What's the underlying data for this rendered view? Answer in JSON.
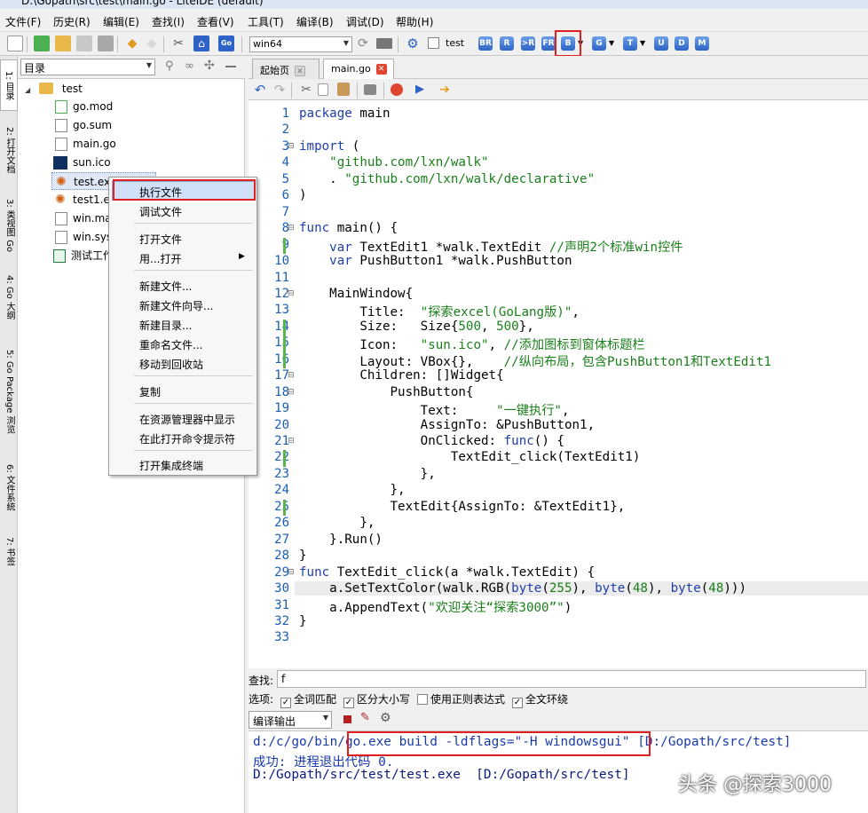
{
  "window": {
    "title": "D:\\Gopath\\src\\test\\main.go - LiteIDE (default)"
  },
  "menubar": [
    "文件(F)",
    "历史(R)",
    "编辑(E)",
    "查找(I)",
    "查看(V)",
    "工具(T)",
    "编译(B)",
    "调试(D)",
    "帮助(H)"
  ],
  "toolbar": {
    "platform": "win64",
    "test_label": "test",
    "build_buttons": [
      "BR",
      "R",
      ">R",
      "FR",
      "B",
      "G",
      "T",
      "U",
      "D",
      "M"
    ]
  },
  "vertical_tabs": [
    "1: 目录",
    "2: 打开文档",
    "3: 类视图 Go",
    "4: Go 大纲",
    "5: Go Package 浏览",
    "6: 文件系统",
    "7: 书签"
  ],
  "sidebar": {
    "combo": "目录",
    "root": "test",
    "files": [
      "go.mod",
      "go.sum",
      "main.go",
      "sun.ico",
      "test.exe",
      "test1.exe",
      "win.manifest",
      "win.syso",
      "测试工作簿.xlsx"
    ]
  },
  "context_menu": {
    "items": [
      "执行文件",
      "调试文件",
      "打开文件",
      "用...打开",
      "新建文件...",
      "新建文件向导...",
      "新建目录...",
      "重命名文件...",
      "移动到回收站",
      "复制",
      "在资源管理器中显示",
      "在此打开命令提示符",
      "打开集成终端"
    ]
  },
  "editor": {
    "tabs": [
      "起始页",
      "main.go"
    ],
    "active_tab": "main.go",
    "line_count": 33,
    "lines": [
      "package main",
      "",
      "import (",
      "    \"github.com/lxn/walk\"",
      "    . \"github.com/lxn/walk/declarative\"",
      ")",
      "",
      "func main() {",
      "    var TextEdit1 *walk.TextEdit //声明2个标准win控件",
      "    var PushButton1 *walk.PushButton",
      "",
      "    MainWindow{",
      "        Title:  \"探索excel(GoLang版)\",",
      "        Size:   Size{500, 500},",
      "        Icon:   \"sun.ico\", //添加图标到窗体标题栏",
      "        Layout: VBox{},    //纵向布局，包含PushButton1和TextEdit1",
      "        Children: []Widget{",
      "            PushButton{",
      "                Text:     \"一键执行\",",
      "                AssignTo: &PushButton1,",
      "                OnClicked: func() {",
      "                    TextEdit_click(TextEdit1)",
      "                },",
      "            },",
      "            TextEdit{AssignTo: &TextEdit1},",
      "        },",
      "    }.Run()",
      "}",
      "func TextEdit_click(a *walk.TextEdit) {",
      "    a.SetTextColor(walk.RGB(byte(255), byte(48), byte(48)))",
      "    a.AppendText(\"欢迎关注“探索3000”\")",
      "}",
      ""
    ]
  },
  "find": {
    "label": "查找:",
    "value": "f"
  },
  "options": {
    "label": "选项:",
    "checks": [
      {
        "label": "全词匹配",
        "checked": true
      },
      {
        "label": "区分大小写",
        "checked": true
      },
      {
        "label": "使用正则表达式",
        "checked": false
      },
      {
        "label": "全文环绕",
        "checked": true
      }
    ]
  },
  "output": {
    "panel": "编译输出",
    "lines": [
      "d:/c/go/bin/go.exe build -ldflags=\"-H windowsgui\" [D:/Gopath/src/test]",
      "成功: 进程退出代码 0.",
      "D:/Gopath/src/test/test.exe  [D:/Gopath/src/test]"
    ]
  },
  "watermark": "头条 @探索3000"
}
